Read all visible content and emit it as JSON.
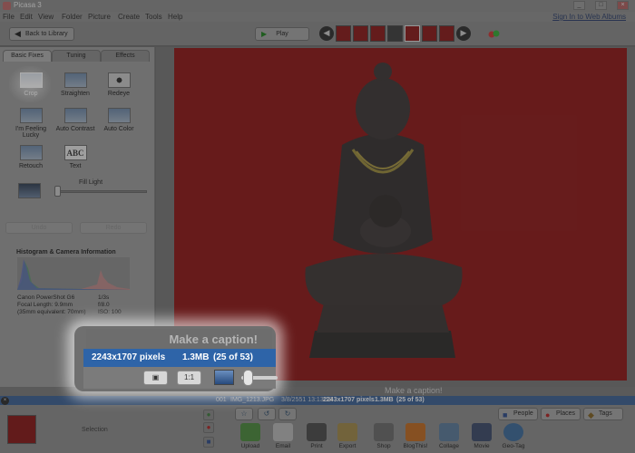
{
  "window": {
    "title": "Picasa 3",
    "controls": [
      "_",
      "□",
      "×"
    ]
  },
  "menu": {
    "items": [
      "File",
      "Edit",
      "View",
      "Folder",
      "Picture",
      "Create",
      "Tools",
      "Help"
    ],
    "sign_in": "Sign In to Web Albums"
  },
  "toolbar": {
    "back_label": "Back to Library",
    "play_label": "Play"
  },
  "left_panel": {
    "tabs": [
      "Basic Fixes",
      "Tuning",
      "Effects"
    ],
    "tools": [
      "Crop",
      "Straighten",
      "Redeye",
      "I'm Feeling Lucky",
      "Auto Contrast",
      "Auto Color",
      "Retouch",
      "Text"
    ],
    "text_icon": "ABC",
    "fill_light_label": "Fill Light",
    "fill_light_value": 0,
    "undo_label": "Undo",
    "redo_label": "Redo",
    "histogram_title": "Histogram & Camera Information",
    "camera": {
      "model": "Canon PowerShot G6",
      "focal_length": "Focal Length: 9.9mm",
      "equivalent": "(35mm equivalent: 70mm)",
      "shutter": "1/3s",
      "aperture": "f/8.0",
      "iso": "ISO: 100"
    }
  },
  "caption": {
    "placeholder": "Make a caption!"
  },
  "info_bar": {
    "index": "001",
    "filename": "IMG_1213.JPG",
    "datetime": "3/8/2551 13:13:18",
    "dimensions": "2243x1707 pixels",
    "size": "1.3MB",
    "position": "(25 of 53)"
  },
  "callout": {
    "caption": "Make a caption!",
    "dimensions": "2243x1707 pixels",
    "size": "1.3MB",
    "position": "(25 of 53)",
    "one_to_one": "1:1"
  },
  "bottom": {
    "selection_label": "Selection",
    "actions": [
      "Upload",
      "Email",
      "Print",
      "Export",
      "Shop",
      "BlogThis!",
      "Collage",
      "Movie",
      "Geo-Tag"
    ],
    "right_buttons": [
      "People",
      "Places",
      "Tags"
    ]
  },
  "colors": {
    "photo_background": "#8e1414",
    "info_bar": "#3a5f93",
    "callout_info": "#2e64a8"
  }
}
